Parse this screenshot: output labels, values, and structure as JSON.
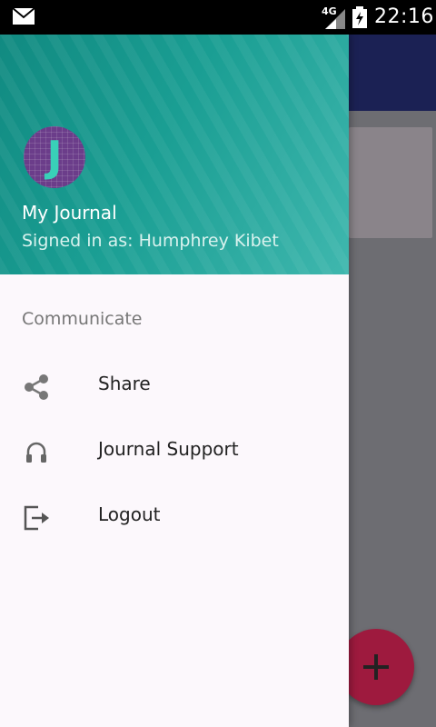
{
  "status_bar": {
    "network": "4G",
    "time": "22:16",
    "icons": [
      "mail-icon",
      "signal-icon",
      "battery-charging-icon"
    ]
  },
  "drawer": {
    "header": {
      "avatar_letter": "J",
      "app_name": "My Journal",
      "signed_in": "Signed in as: Humphrey Kibet"
    },
    "section_title": "Communicate",
    "items": [
      {
        "label": "Share",
        "icon": "share-icon"
      },
      {
        "label": "Journal Support",
        "icon": "headset-icon"
      },
      {
        "label": "Logout",
        "icon": "logout-icon"
      }
    ]
  },
  "fab": {
    "icon": "plus-icon"
  },
  "colors": {
    "header_teal": "#1a9e93",
    "app_bar": "#1b2154",
    "fab": "#9e1a3e",
    "avatar_bg": "#6b3d8a"
  }
}
